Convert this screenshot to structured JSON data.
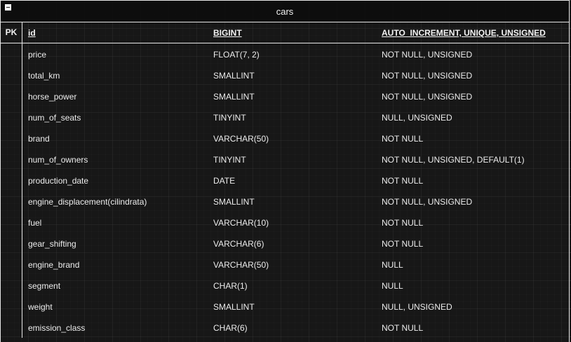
{
  "table": {
    "title": "cars",
    "pk_label": "PK",
    "primary_key": {
      "name": "id",
      "type": "BIGINT",
      "constraints": "AUTO_INCREMENT, UNIQUE, UNSIGNED"
    },
    "columns": [
      {
        "name": "price",
        "type": "FLOAT(7, 2)",
        "constraints": "NOT NULL, UNSIGNED"
      },
      {
        "name": "total_km",
        "type": "SMALLINT",
        "constraints": "NOT NULL, UNSIGNED"
      },
      {
        "name": "horse_power",
        "type": "SMALLINT",
        "constraints": "NOT NULL, UNSIGNED"
      },
      {
        "name": "num_of_seats",
        "type": "TINYINT",
        "constraints": "NULL, UNSIGNED"
      },
      {
        "name": "brand",
        "type": "VARCHAR(50)",
        "constraints": "NOT NULL"
      },
      {
        "name": "num_of_owners",
        "type": "TINYINT",
        "constraints": "NOT NULL, UNSIGNED, DEFAULT(1)"
      },
      {
        "name": "production_date",
        "type": "DATE",
        "constraints": "NOT NULL"
      },
      {
        "name": "engine_displacement(cilindrata)",
        "type": "SMALLINT",
        "constraints": "NOT NULL, UNSIGNED"
      },
      {
        "name": "fuel",
        "type": "VARCHAR(10)",
        "constraints": "NOT NULL"
      },
      {
        "name": "gear_shifting",
        "type": "VARCHAR(6)",
        "constraints": "NOT NULL"
      },
      {
        "name": "engine_brand",
        "type": "VARCHAR(50)",
        "constraints": "NULL"
      },
      {
        "name": "segment",
        "type": "CHAR(1)",
        "constraints": "NULL"
      },
      {
        "name": "weight",
        "type": "SMALLINT",
        "constraints": "NULL, UNSIGNED"
      },
      {
        "name": "emission_class",
        "type": "CHAR(6)",
        "constraints": "NOT NULL"
      }
    ]
  }
}
